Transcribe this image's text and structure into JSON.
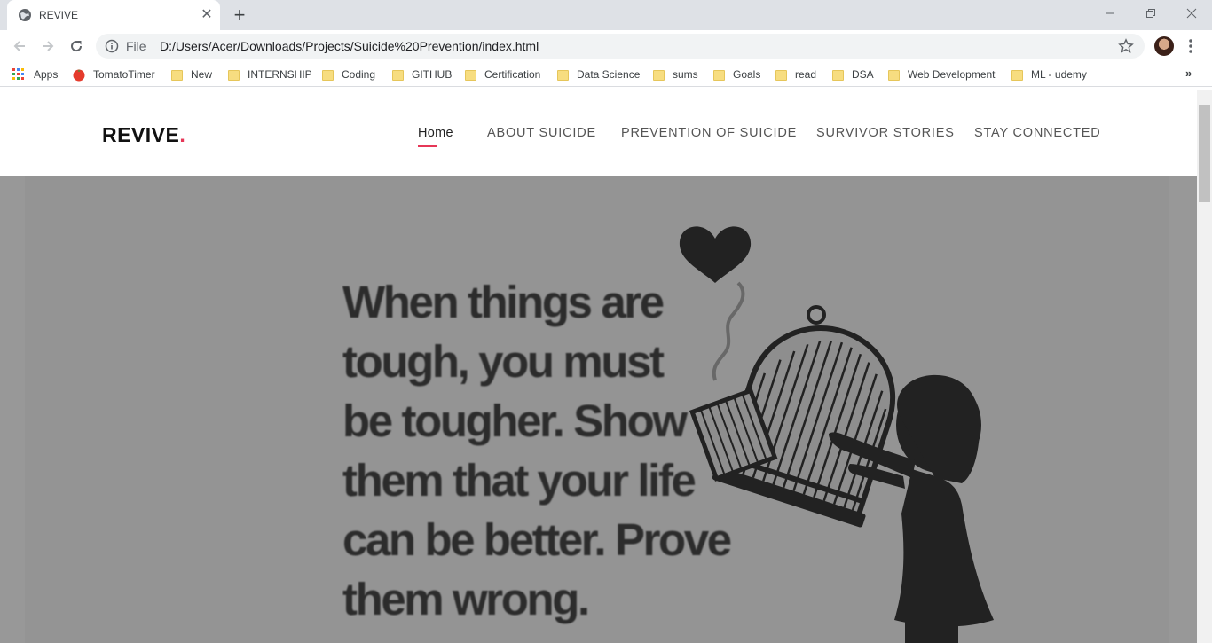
{
  "browser": {
    "tab": {
      "title": "REVIVE"
    },
    "omnibox": {
      "scheme_label": "File",
      "url": "D:/Users/Acer/Downloads/Projects/Suicide%20Prevention/index.html"
    },
    "bookmarks": [
      {
        "label": "Apps",
        "icon": "apps-grid-icon"
      },
      {
        "label": "TomatoTimer",
        "icon": "tomato-icon"
      },
      {
        "label": "New",
        "icon": "folder-icon"
      },
      {
        "label": "INTERNSHIP",
        "icon": "folder-icon"
      },
      {
        "label": "Coding",
        "icon": "folder-icon"
      },
      {
        "label": "GITHUB",
        "icon": "folder-icon"
      },
      {
        "label": "Certification",
        "icon": "folder-icon"
      },
      {
        "label": "Data Science",
        "icon": "folder-icon"
      },
      {
        "label": "sums",
        "icon": "folder-icon"
      },
      {
        "label": "Goals",
        "icon": "folder-icon"
      },
      {
        "label": "read",
        "icon": "folder-icon"
      },
      {
        "label": "DSA",
        "icon": "folder-icon"
      },
      {
        "label": "Web Development",
        "icon": "folder-icon"
      },
      {
        "label": "ML - udemy",
        "icon": "folder-icon"
      }
    ],
    "overflow_label": "»"
  },
  "site": {
    "logo": {
      "text": "REVIVE",
      "dot": "."
    },
    "nav": [
      {
        "label": "Home",
        "active": true
      },
      {
        "label": "ABOUT SUICIDE"
      },
      {
        "label": "PREVENTION OF SUICIDE"
      },
      {
        "label": "SURVIVOR STORIES"
      },
      {
        "label": "STAY CONNECTED"
      }
    ],
    "hero": {
      "quote_lines": [
        "When things are",
        "tough, you must",
        "be tougher. Show",
        "them that your life",
        "can be better. Prove",
        "them wrong."
      ]
    }
  },
  "colors": {
    "accent": "#e63757",
    "hero_bg": "#949494",
    "chrome_bg": "#dee1e6"
  }
}
